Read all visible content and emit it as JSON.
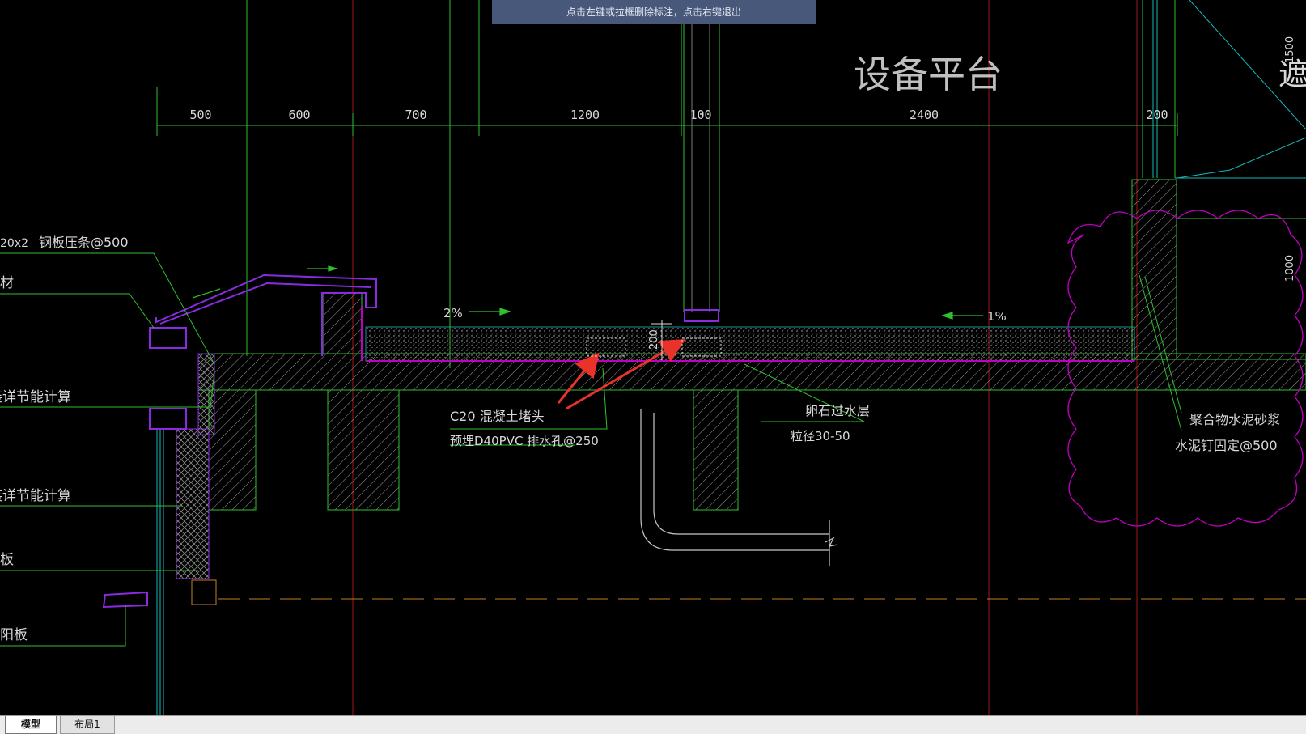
{
  "prompt_bar": {
    "text": "点击左键或拉框删除标注，点击右键退出"
  },
  "drawing": {
    "title": "设备平台",
    "dimensions": [
      "500",
      "600",
      "700",
      "1200",
      "100",
      "2400",
      "200"
    ],
    "slopes": {
      "left": "2%",
      "right": "1%"
    },
    "labels": {
      "steel_strip": "钢板压条@500",
      "steel_strip_prefix": "20x2",
      "material": "材",
      "energy_calc_1": "装详节能计算",
      "energy_calc_2": "装详节能计算",
      "board": "板",
      "sunshade": "阳板",
      "concrete_plug": "C20  混凝土堵头",
      "drain_pipe": "预埋D40PVC   排水孔@250",
      "gravel_layer": "卵石过水层",
      "gravel_size": "粒径30-50",
      "polymer_mortar": "聚合物水泥砂浆",
      "cement_nail": "水泥钉固定@500",
      "height_200": "200",
      "height_1000": "1000",
      "height_1500": "1500",
      "edge_text": "遮"
    }
  },
  "tabs": {
    "model": "模型",
    "layout1": "布局1"
  },
  "colors": {
    "background": "#000000",
    "dim_line": "#2fbf2f",
    "grid_red": "#a01818",
    "purple": "#8a2be2",
    "magenta": "#c000c0",
    "cyan": "#19b8b8",
    "arrow_red": "#e8322a",
    "prompt_bg": "#48587a"
  }
}
